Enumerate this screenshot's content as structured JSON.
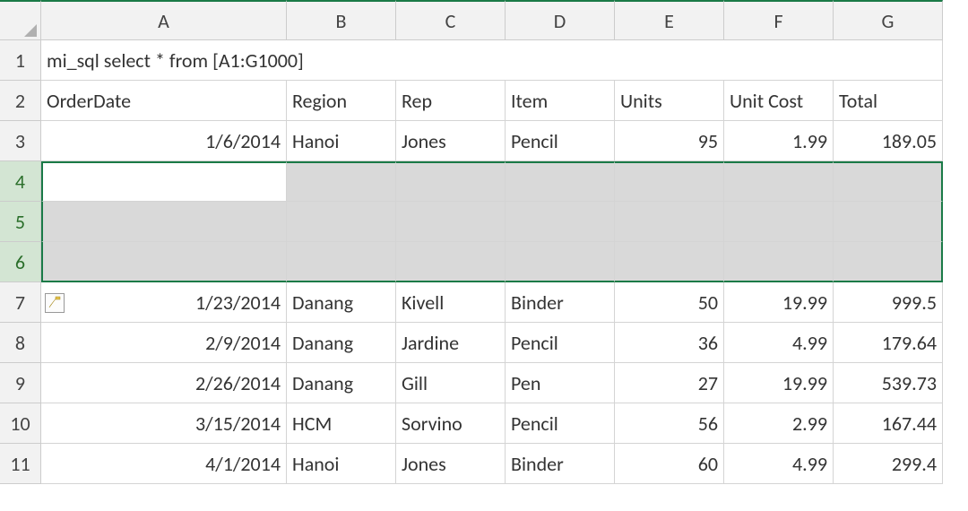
{
  "columns": [
    "A",
    "B",
    "C",
    "D",
    "E",
    "F",
    "G"
  ],
  "rowNumbers": [
    1,
    2,
    3,
    4,
    5,
    6,
    7,
    8,
    9,
    10,
    11
  ],
  "formulaRow": {
    "text": "mi_sql select * from [A1:G1000]"
  },
  "header": {
    "orderDate": "OrderDate",
    "region": "Region",
    "rep": "Rep",
    "item": "Item",
    "units": "Units",
    "unitCost": "Unit Cost",
    "total": "Total"
  },
  "dataRows": [
    {
      "date": "1/6/2014",
      "region": "Hanoi",
      "rep": "Jones",
      "item": "Pencil",
      "units": "95",
      "unitCost": "1.99",
      "total": "189.05"
    },
    {
      "date": "1/23/2014",
      "region": "Danang",
      "rep": "Kivell",
      "item": "Binder",
      "units": "50",
      "unitCost": "19.99",
      "total": "999.5"
    },
    {
      "date": "2/9/2014",
      "region": "Danang",
      "rep": "Jardine",
      "item": "Pencil",
      "units": "36",
      "unitCost": "4.99",
      "total": "179.64"
    },
    {
      "date": "2/26/2014",
      "region": "Danang",
      "rep": "Gill",
      "item": "Pen",
      "units": "27",
      "unitCost": "19.99",
      "total": "539.73"
    },
    {
      "date": "3/15/2014",
      "region": "HCM",
      "rep": "Sorvino",
      "item": "Pencil",
      "units": "56",
      "unitCost": "2.99",
      "total": "167.44"
    },
    {
      "date": "4/1/2014",
      "region": "Hanoi",
      "rep": "Jones",
      "item": "Binder",
      "units": "60",
      "unitCost": "4.99",
      "total": "299.4"
    }
  ],
  "selection": {
    "fromRow": 4,
    "toRow": 6,
    "fromCol": "A",
    "toCol": "G",
    "activeCell": "A4"
  },
  "smartTag": "paste-options-icon"
}
